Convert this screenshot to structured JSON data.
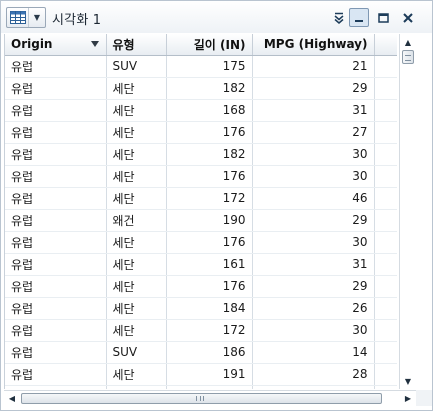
{
  "window": {
    "title": "시각화 1",
    "icons": {
      "table_view": "grid-table-icon",
      "dropdown": "caret-down-icon",
      "menu": "double-chevron-down-icon",
      "minimize": "minimize-icon",
      "maximize": "maximize-icon",
      "close": "close-icon"
    },
    "glyphs": {
      "caret": "▼",
      "menu": "⇊",
      "minimize": "▁",
      "maximize": "□",
      "close": "✕"
    }
  },
  "table": {
    "columns": [
      {
        "label": "Origin",
        "sorted": true
      },
      {
        "label": "유형"
      },
      {
        "label": "길이 (IN)"
      },
      {
        "label": "MPG (Highway)"
      }
    ],
    "rows": [
      [
        "유럽",
        "SUV",
        "175",
        "21"
      ],
      [
        "유럽",
        "세단",
        "182",
        "29"
      ],
      [
        "유럽",
        "세단",
        "168",
        "31"
      ],
      [
        "유럽",
        "세단",
        "176",
        "27"
      ],
      [
        "유럽",
        "세단",
        "182",
        "30"
      ],
      [
        "유럽",
        "세단",
        "176",
        "30"
      ],
      [
        "유럽",
        "세단",
        "172",
        "46"
      ],
      [
        "유럽",
        "왜건",
        "190",
        "29"
      ],
      [
        "유럽",
        "세단",
        "176",
        "30"
      ],
      [
        "유럽",
        "세단",
        "161",
        "31"
      ],
      [
        "유럽",
        "세단",
        "176",
        "29"
      ],
      [
        "유럽",
        "세단",
        "184",
        "26"
      ],
      [
        "유럽",
        "세단",
        "172",
        "30"
      ],
      [
        "유럽",
        "SUV",
        "186",
        "14"
      ],
      [
        "유럽",
        "세단",
        "191",
        "28"
      ],
      [
        "",
        "",
        "",
        ""
      ]
    ]
  },
  "scrollbars": {
    "vertical": {
      "arrow_up": "▲",
      "arrow_down": "▼",
      "position": 0.0
    },
    "horizontal": {
      "arrow_left": "◀",
      "arrow_right": "▶",
      "position": 0.0
    }
  }
}
